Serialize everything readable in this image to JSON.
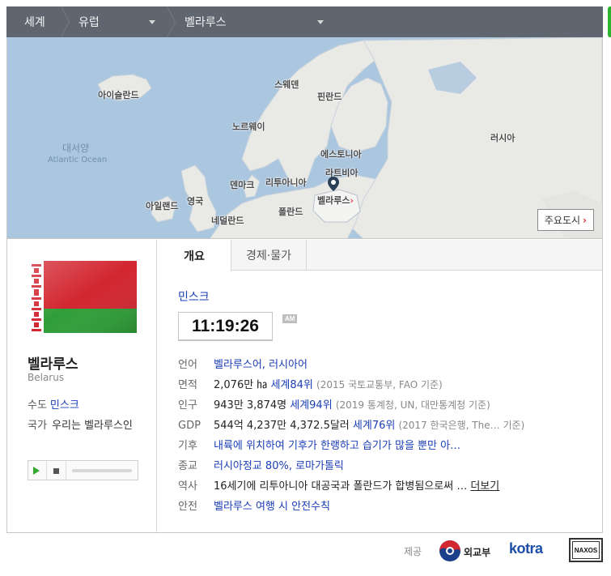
{
  "nav": {
    "world": "세계",
    "region": "유럽",
    "country": "벨라루스"
  },
  "map": {
    "labels": {
      "iceland": "아이슬란드",
      "sweden": "스웨덴",
      "finland": "핀란드",
      "norway": "노르웨이",
      "russia": "러시아",
      "estonia": "에스토니아",
      "latvia": "라트비아",
      "denmark": "덴마크",
      "lithuania": "리투아니아",
      "ireland": "아일랜드",
      "uk": "영국",
      "netherlands": "네덜란드",
      "poland": "폴란드",
      "belarus": "벨라루스",
      "ocean_ko": "대서양",
      "ocean_en": "Atlantic Ocean"
    },
    "capital_button": "주요도시"
  },
  "country": {
    "name_ko": "벨라루스",
    "name_en": "Belarus",
    "capital_label": "수도",
    "capital": "민스크",
    "anthem_label": "국가",
    "anthem": "우리는 벨라루스인"
  },
  "tabs": {
    "overview": "개요",
    "economy": "경제·물가"
  },
  "overview": {
    "city": "민스크",
    "time": "11:19:26",
    "ampm": "AM",
    "rows": {
      "language": {
        "k": "언어",
        "v": "벨라루스어, 러시아어"
      },
      "area": {
        "k": "면적",
        "v": "2,076만 ㏊",
        "rank": "세계84위",
        "src": "(2015 국토교통부, FAO 기준)"
      },
      "population": {
        "k": "인구",
        "v": "943만 3,874명",
        "rank": "세계94위",
        "src": "(2019 통계청, UN, 대만통계청 기준)"
      },
      "gdp": {
        "k": "GDP",
        "v": "544억 4,237만 4,372.5달러",
        "rank": "세계76위",
        "src": "(2017 한국은행, The…   기준)"
      },
      "climate": {
        "k": "기후",
        "v": "내륙에 위치하여 기후가 한랭하고 습기가 많을 뿐만 아…"
      },
      "religion": {
        "k": "종교",
        "v": "러시아정교 80%, 로마가톨릭"
      },
      "history": {
        "k": "역사",
        "v": "16세기에 리투아니아 대공국과 폴란드가 합병됨으로써 …",
        "more": "더보기"
      },
      "safety": {
        "k": "안전",
        "v": "벨라루스 여행 시 안전수칙"
      }
    }
  },
  "footer": {
    "provided": "제공",
    "mofa": "외교부",
    "kotra": "kotra",
    "naxos": "NAXOS"
  },
  "colors": {
    "flag_red": "#d22630",
    "flag_green": "#2f9e38",
    "link": "#1a3db5",
    "nav_bg": "#5f6670",
    "sea": "#abc6df",
    "land": "#e9e9e6"
  }
}
